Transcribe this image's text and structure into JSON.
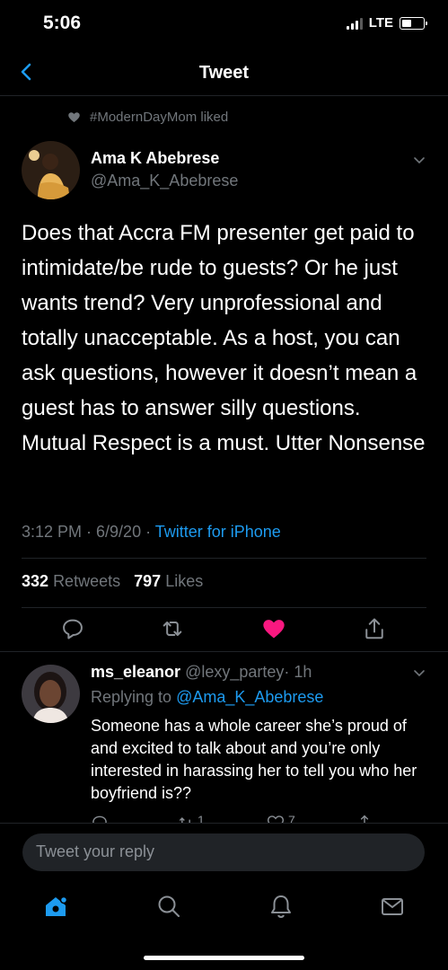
{
  "status": {
    "time": "5:06",
    "network": "LTE"
  },
  "header": {
    "title": "Tweet"
  },
  "social_context": "#ModernDayMom liked",
  "tweet": {
    "name": "Ama K Abebrese",
    "handle": "@Ama_K_Abebrese",
    "text": "Does that Accra FM presenter get paid to intimidate/be rude to guests? Or he just wants trend? Very unprofessional and totally unacceptable. As a host, you can ask questions, however it doesn’t mean a guest has to answer silly questions. Mutual Respect is a must. Utter Nonsense",
    "datetime": "3:12 PM · 6/9/20 · ",
    "source": "Twitter for iPhone",
    "retweets": "332",
    "retweets_label": "Retweets",
    "likes": "797",
    "likes_label": "Likes",
    "liked": true
  },
  "reply": {
    "name": "ms_eleanor",
    "handle": "@lexy_partey",
    "time": "· 1h",
    "replying_prefix": "Replying to",
    "replying_to": "@Ama_K_Abebrese",
    "text": "Someone has a whole career she’s proud of and excited to talk about and you’re only interested in harassing her to tell you who her boyfriend is??",
    "retweet_count": "1",
    "like_count": "7"
  },
  "composer": {
    "placeholder": "Tweet your reply"
  },
  "colors": {
    "accent": "#1d9bf0",
    "like": "#f91880",
    "secondary": "#71767b"
  },
  "tabs": [
    "home-icon",
    "search-icon",
    "notifications-icon",
    "messages-icon"
  ]
}
